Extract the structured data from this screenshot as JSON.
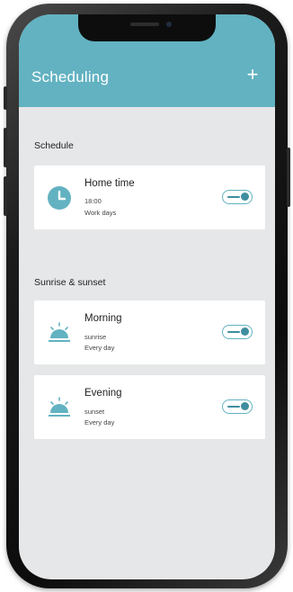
{
  "header": {
    "title": "Scheduling",
    "add_label": "+",
    "color": "#62b2c1"
  },
  "schedule": {
    "section_title": "Schedule",
    "items": [
      {
        "name": "Home time",
        "time": "18:00",
        "days": "Work days",
        "icon": "clock-icon",
        "enabled": true
      }
    ]
  },
  "sunrise_sunset": {
    "section_title": "Sunrise & sunset",
    "items": [
      {
        "name": "Morning",
        "event": "sunrise",
        "days": "Every day",
        "icon": "sun-horizon-icon",
        "enabled": true
      },
      {
        "name": "Evening",
        "event": "sunset",
        "days": "Every day",
        "icon": "sun-horizon-icon",
        "enabled": true
      }
    ]
  }
}
